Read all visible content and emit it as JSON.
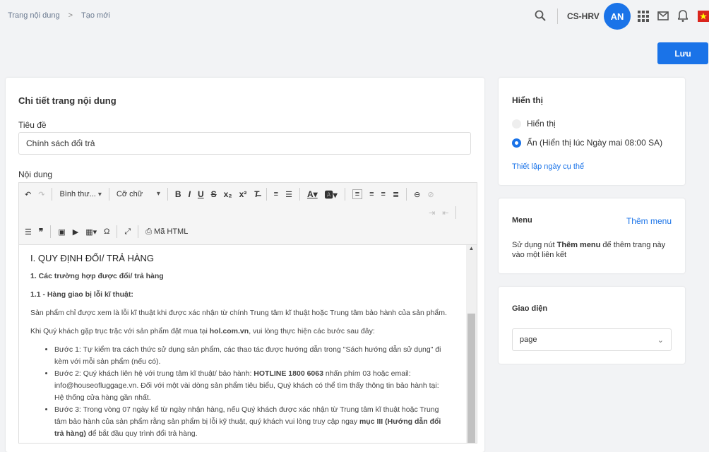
{
  "breadcrumb": {
    "items": [
      "Trang nội dung",
      "Tạo mới"
    ],
    "separator": ">"
  },
  "header": {
    "store": "CS-HRV",
    "avatar": "AN",
    "accent": "#1a73e8"
  },
  "actions": {
    "save": "Lưu"
  },
  "main": {
    "title": "Chi tiết trang nội dung",
    "title_label": "Tiêu đề",
    "title_value": "Chính sách đổi trả",
    "content_label": "Nội dung",
    "toolbar": {
      "format": "Bình thư...",
      "font_size": "Cỡ chữ",
      "html": "Mã HTML"
    },
    "body": {
      "h1": "I. QUY ĐỊNH ĐỔI/ TRẢ HÀNG",
      "h2": "1. Các trường hợp được đổi/ trả hàng",
      "h3": "1.1 - Hàng giao bị lỗi kĩ thuật:",
      "p1": "Sản phẩm chỉ được xem là lỗi kĩ thuật khi được xác nhận từ chính Trung tâm kĩ thuật hoặc Trung tâm bảo hành của sản phẩm.",
      "p2a": "Khi Quý khách gặp trục trặc với sản phẩm đặt mua tại ",
      "p2b": "hol.com.vn",
      "p2c": ", vui lòng thực hiện các bước sau đây:",
      "s1": "Bước 1: Tự kiểm tra cách thức sử dụng sản phẩm, các thao tác được hướng dẫn trong \"Sách hướng dẫn sử dụng\" đi kèm với mỗi sản phẩm (nếu có).",
      "s2a": "Bước 2: Quý khách liên hệ với trung tâm kĩ thuật/ bảo hành: ",
      "s2b": "HOTLINE 1800 6063",
      "s2c": " nhấn phím 03 hoặc email: info@houseofluggage.vn. Đối với một vài dòng sản phẩm tiêu biểu, Quý khách có thể tìm thấy thông tin bảo hành tại: Hệ thống cửa hàng gần nhất.",
      "s3a": "Bước 3: Trong vòng 07 ngày kể từ ngày nhận hàng, nếu Quý khách được xác nhận từ Trung tâm kĩ thuật hoặc Trung tâm bảo hành của sản phẩm rằng sản phẩm bị lỗi kỹ thuật, quý khách vui lòng truy cập ngay ",
      "s3b": "mục III (Hướng dẫn đổi trả hàng)",
      "s3c": " để bắt đầu quy trình đổi trả hàng."
    }
  },
  "visibility": {
    "title": "Hiển thị",
    "opt1": "Hiển thị",
    "opt2": "Ẩn (Hiển thị lúc Ngày mai 08:00 SA)",
    "selected": "opt2",
    "link": "Thiết lập ngày cụ thể"
  },
  "menu": {
    "title": "Menu",
    "add": "Thêm menu",
    "desc_a": "Sử dụng nút ",
    "desc_b": "Thêm menu",
    "desc_c": " để thêm trang này vào một liên kết"
  },
  "theme": {
    "title": "Giao diện",
    "value": "page"
  }
}
